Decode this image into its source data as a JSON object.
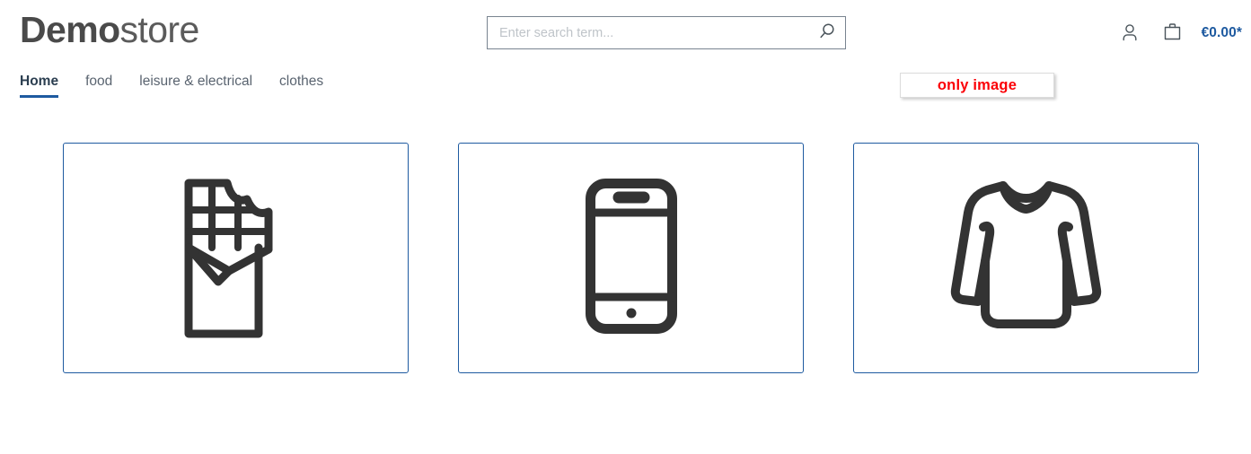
{
  "header": {
    "logo": {
      "strong": "Demo",
      "light": "store"
    },
    "search": {
      "placeholder": "Enter search term...",
      "value": "",
      "icon": "search-icon"
    },
    "actions": {
      "account_icon": "person-icon",
      "cart_icon": "shopping-bag-icon",
      "cart_total": "€0.00*"
    }
  },
  "nav": {
    "items": [
      {
        "label": "Home",
        "active": true
      },
      {
        "label": "food",
        "active": false
      },
      {
        "label": "leisure & electrical",
        "active": false
      },
      {
        "label": "clothes",
        "active": false
      }
    ]
  },
  "badge": {
    "label": "only image",
    "color": "#fb0007"
  },
  "cards": [
    {
      "name": "card-chocolate",
      "icon": "chocolate-bar-icon"
    },
    {
      "name": "card-smartphone",
      "icon": "smartphone-icon"
    },
    {
      "name": "card-shirt",
      "icon": "long-sleeve-shirt-icon"
    }
  ],
  "colors": {
    "accent_blue": "#1e5aa0",
    "icon_dark": "#333333",
    "text_gray": "#5a6470",
    "badge_red": "#fb0007"
  }
}
